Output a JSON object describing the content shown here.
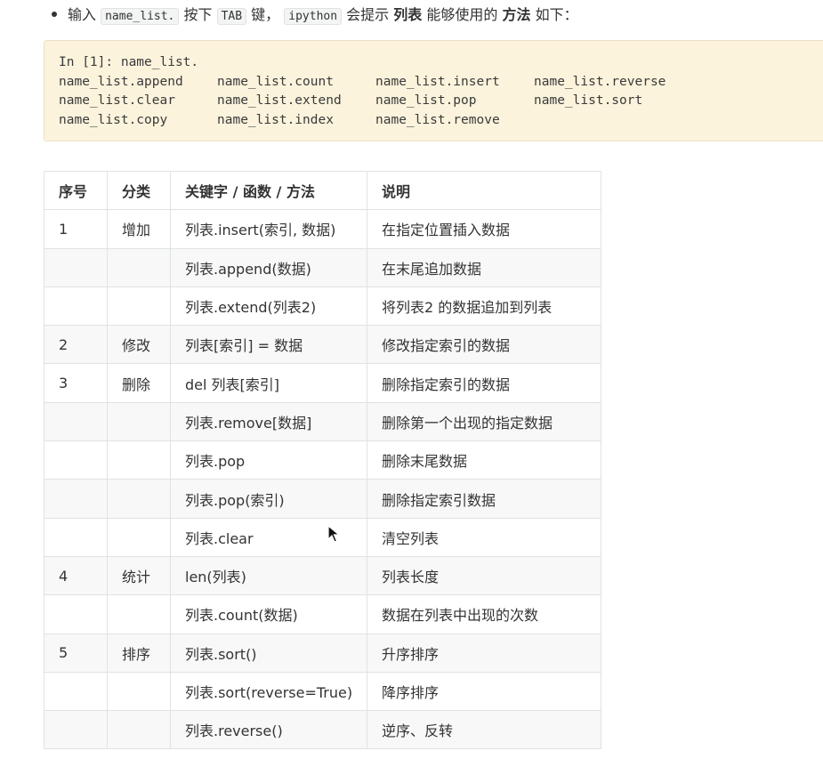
{
  "intro": {
    "p1": "输入",
    "code1": "name_list.",
    "p2": "按下",
    "code2": "TAB",
    "p3": "键，",
    "code3": "ipython",
    "p4": "会提示",
    "bold1": "列表",
    "p5": "能够使用的",
    "bold2": "方法",
    "p6": "如下："
  },
  "code": {
    "prompt": "In [1]: name_list.",
    "rows": [
      [
        "name_list.append",
        "name_list.count",
        "name_list.insert",
        "name_list.reverse"
      ],
      [
        "name_list.clear",
        "name_list.extend",
        "name_list.pop",
        "name_list.sort"
      ],
      [
        "name_list.copy",
        "name_list.index",
        "name_list.remove",
        ""
      ]
    ]
  },
  "table": {
    "headers": [
      "序号",
      "分类",
      "关键字 / 函数 / 方法",
      "说明"
    ],
    "rows": [
      [
        "1",
        "增加",
        "列表.insert(索引, 数据)",
        "在指定位置插入数据"
      ],
      [
        "",
        "",
        "列表.append(数据)",
        "在末尾追加数据"
      ],
      [
        "",
        "",
        "列表.extend(列表2)",
        "将列表2 的数据追加到列表"
      ],
      [
        "2",
        "修改",
        "列表[索引] = 数据",
        "修改指定索引的数据"
      ],
      [
        "3",
        "删除",
        "del 列表[索引]",
        "删除指定索引的数据"
      ],
      [
        "",
        "",
        "列表.remove[数据]",
        "删除第一个出现的指定数据"
      ],
      [
        "",
        "",
        "列表.pop",
        "删除末尾数据"
      ],
      [
        "",
        "",
        "列表.pop(索引)",
        "删除指定索引数据"
      ],
      [
        "",
        "",
        "列表.clear",
        "清空列表"
      ],
      [
        "4",
        "统计",
        "len(列表)",
        "列表长度"
      ],
      [
        "",
        "",
        "列表.count(数据)",
        "数据在列表中出现的次数"
      ],
      [
        "5",
        "排序",
        "列表.sort()",
        "升序排序"
      ],
      [
        "",
        "",
        "列表.sort(reverse=True)",
        "降序排序"
      ],
      [
        "",
        "",
        "列表.reverse()",
        "逆序、反转"
      ]
    ]
  },
  "cursor_icon": "mouse-pointer-icon"
}
